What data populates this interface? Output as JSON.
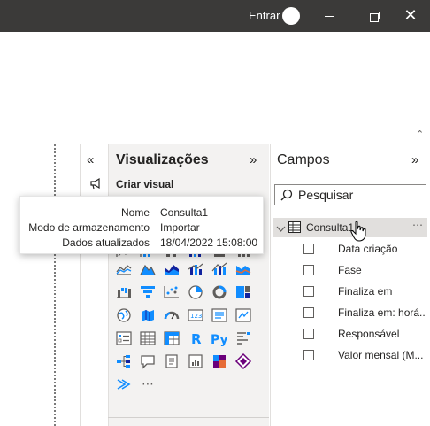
{
  "titlebar": {
    "signin_label": "Entrar",
    "window_controls": [
      "minimize-icon",
      "restore-icon",
      "close-icon"
    ],
    "close_glyph": "✕"
  },
  "ribbon": {
    "collapse_glyph": "⌃"
  },
  "filters_strip": {
    "collapse_glyph": "«",
    "icon": "megaphone-icon"
  },
  "visualizations": {
    "title": "Visualizações",
    "collapse_glyph": "»",
    "subtitle": "Criar visual",
    "more_glyph": "⋯",
    "icons": [
      [
        "stacked-area-icon",
        "area-icon",
        "line-clustered-icon",
        "ribbon-chart-icon",
        "waterfall-icon",
        "line-stacked-icon"
      ],
      [
        "funnel-bars-icon",
        "funnel-icon",
        "scatter-icon",
        "pie-icon",
        "donut-icon",
        "treemap-icon"
      ],
      [
        "map-icon",
        "filled-map-icon",
        "gauge-icon",
        "card-icon",
        "multirow-card-icon",
        "kpi-icon"
      ],
      [
        "slicer-icon",
        "table-icon",
        "matrix-icon",
        "r-visual-icon",
        "python-visual-icon",
        "key-influencers-icon"
      ],
      [
        "decomposition-tree-icon",
        "qa-icon",
        "smart-narrative-icon",
        "paginated-report-icon",
        "power-apps-icon",
        "power-automate-icon"
      ],
      [
        "more-visuals-icon"
      ]
    ],
    "r_label": "R",
    "py_label": "Py",
    "colors": {
      "blue": "#118dff",
      "navy": "#12239e",
      "orange": "#e66c37",
      "purple": "#6b007b",
      "gray": "#605e5c"
    }
  },
  "fields": {
    "title": "Campos",
    "collapse_glyph": "»",
    "search": {
      "placeholder": "Pesquisar"
    },
    "table": {
      "name": "Consulta1",
      "more_glyph": "⋯"
    },
    "items": [
      {
        "label": "Data criação"
      },
      {
        "label": "Fase"
      },
      {
        "label": "Finaliza em"
      },
      {
        "label": "Finaliza em: horá..."
      },
      {
        "label": "Responsável"
      },
      {
        "label": "Valor mensal (M..."
      }
    ]
  },
  "tooltip": {
    "rows": [
      {
        "key": "Nome",
        "value": "Consulta1"
      },
      {
        "key": "Modo de armazenamento",
        "value": "Importar"
      },
      {
        "key": "Dados atualizados",
        "value": "18/04/2022 15:08:00"
      }
    ]
  }
}
